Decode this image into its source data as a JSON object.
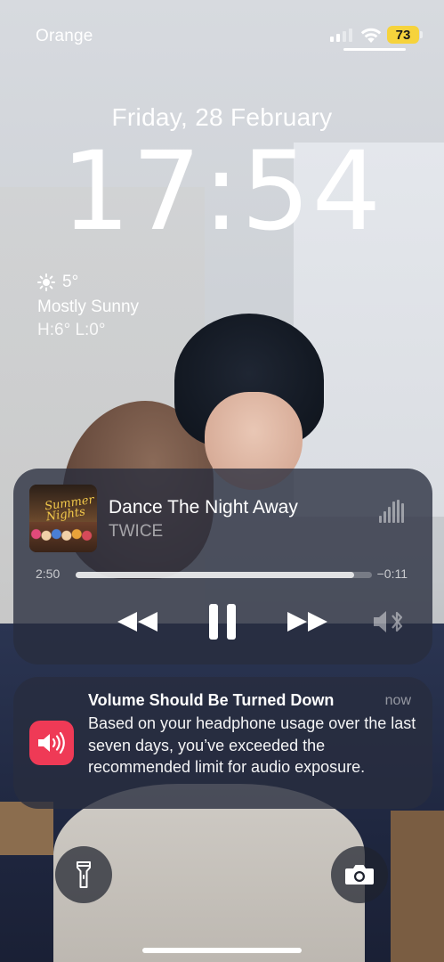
{
  "status_bar": {
    "carrier": "Orange",
    "battery_level": "73",
    "battery_color": "#f6d33c",
    "icons": [
      "cellular-signal-icon",
      "wifi-icon",
      "battery-icon"
    ]
  },
  "lock_screen": {
    "date": "Friday, 28 February",
    "time": "17:54"
  },
  "weather": {
    "icon": "sun-icon",
    "temperature": "5°",
    "condition": "Mostly Sunny",
    "high_low": "H:6° L:0°"
  },
  "now_playing": {
    "track_title": "Dance The Night Away",
    "artist": "TWICE",
    "album_art_text": "Summer Nights",
    "elapsed": "2:50",
    "remaining": "−0:11",
    "progress": 0.94,
    "controls": {
      "rewind": "rewind-icon",
      "play_pause": "pause-icon",
      "forward": "fast-forward-icon",
      "output": "speaker-bluetooth-icon"
    }
  },
  "notification": {
    "app_icon": "speaker-volume-icon",
    "app_icon_color": "#ef3a56",
    "title": "Volume Should Be Turned Down",
    "time": "now",
    "body": "Based on your headphone usage over the last seven days, you’ve exceeded the recommended limit for audio exposure."
  },
  "quick_actions": {
    "left": "flashlight-icon",
    "right": "camera-icon"
  }
}
